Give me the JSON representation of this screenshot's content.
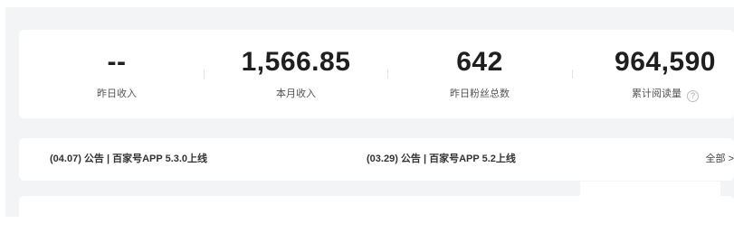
{
  "stats": [
    {
      "value": "--",
      "label": "昨日收入"
    },
    {
      "value": "1,566.85",
      "label": "本月收入"
    },
    {
      "value": "642",
      "label": "昨日粉丝总数"
    },
    {
      "value": "964,590",
      "label": "累计阅读量"
    }
  ],
  "help_icon_glyph": "?",
  "notices": [
    {
      "text": "(04.07) 公告 | 百家号APP 5.3.0上线"
    },
    {
      "text": "(03.29) 公告 | 百家号APP 5.2上线"
    }
  ],
  "all_link": "全部 >"
}
